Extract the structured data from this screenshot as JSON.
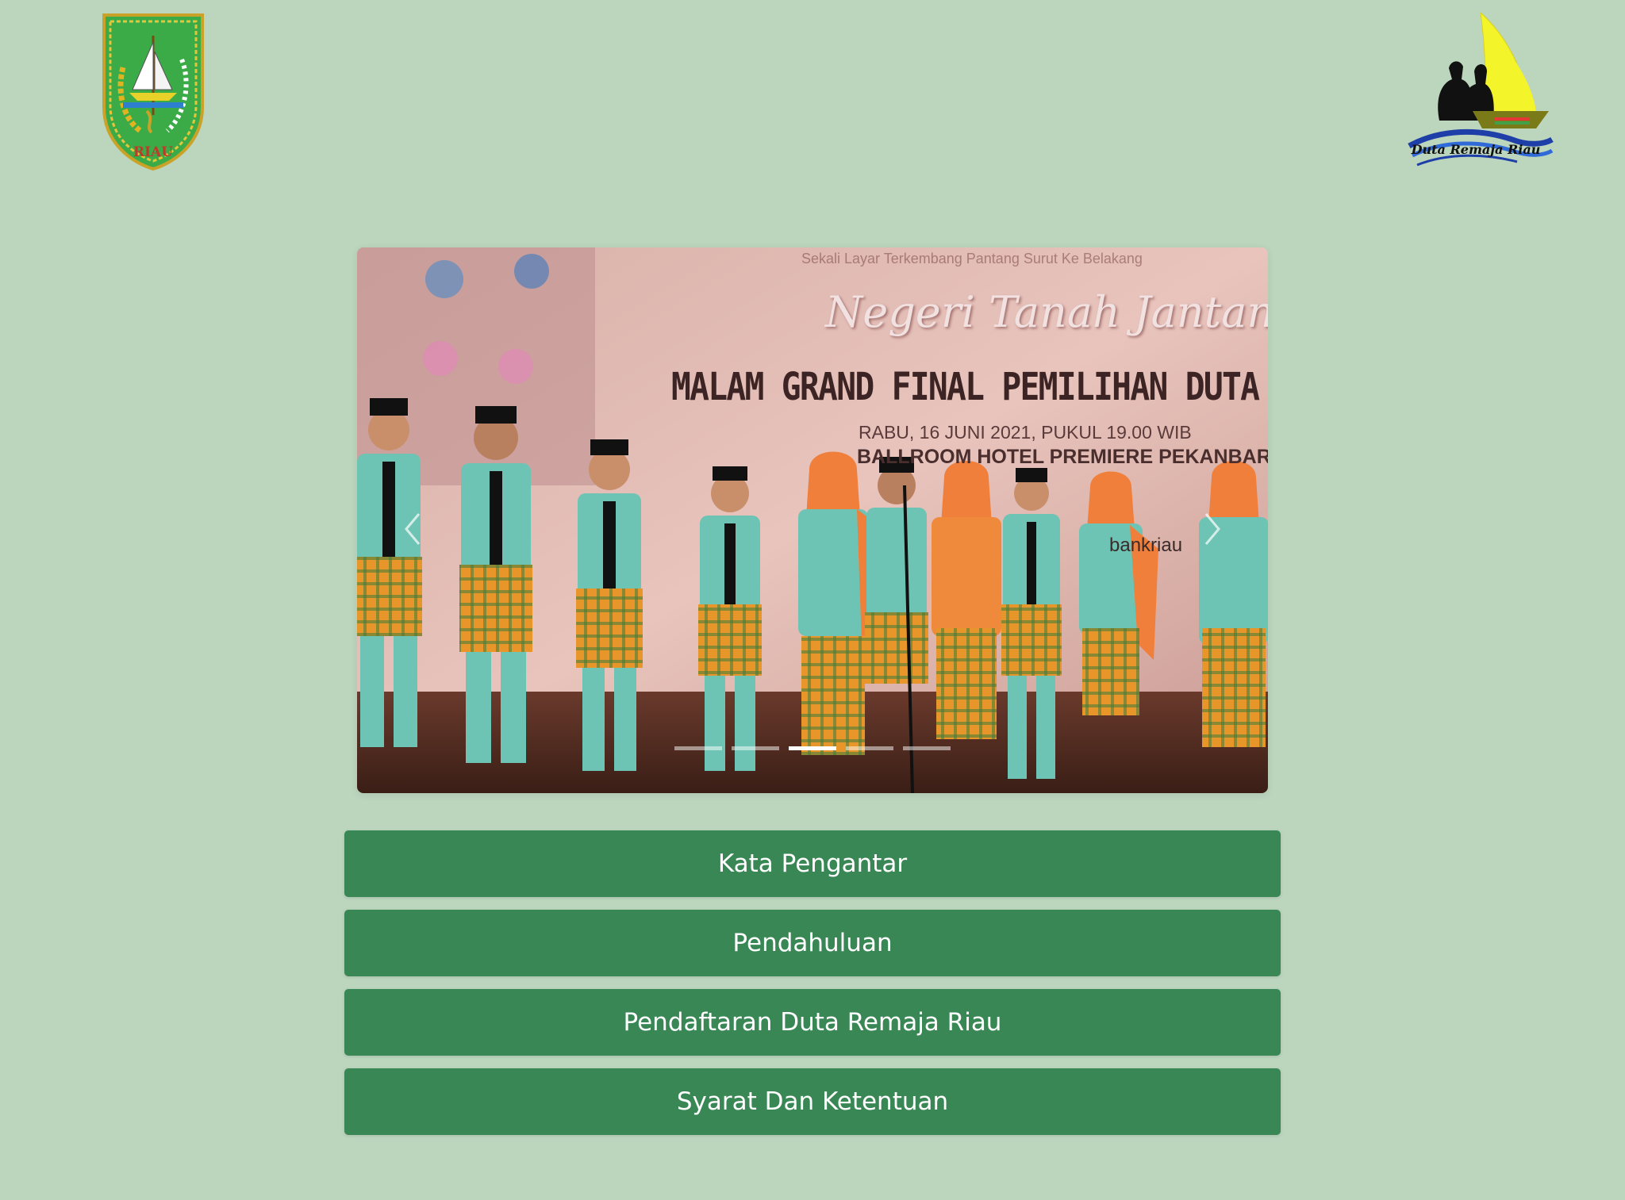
{
  "logos": {
    "left_text": "RIAU",
    "right_text": "Duta Remaja Riau"
  },
  "carousel": {
    "banner": {
      "tagline": "Sekali Layar Terkembang Pantang Surut Ke Belakang",
      "title": "Negeri Tanah Jantan",
      "main": "MALAM GRAND FINAL PEMILIHAN DUTA REMAJA RIAU",
      "date": "RABU, 16 JUNI 2021, PUKUL 19.00 WIB",
      "venue": "BALLROOM HOTEL PREMIERE PEKANBARU",
      "sponsor": "bankriau"
    },
    "indicator_count": 5,
    "active_index": 2
  },
  "menu": {
    "items": [
      {
        "label": "Kata Pengantar"
      },
      {
        "label": "Pendahuluan"
      },
      {
        "label": "Pendaftaran Duta Remaja Riau"
      },
      {
        "label": "Syarat Dan Ketentuan"
      }
    ]
  },
  "colors": {
    "page_background": "#bcd5bd",
    "button_background": "#388754",
    "button_text": "#ffffff"
  }
}
